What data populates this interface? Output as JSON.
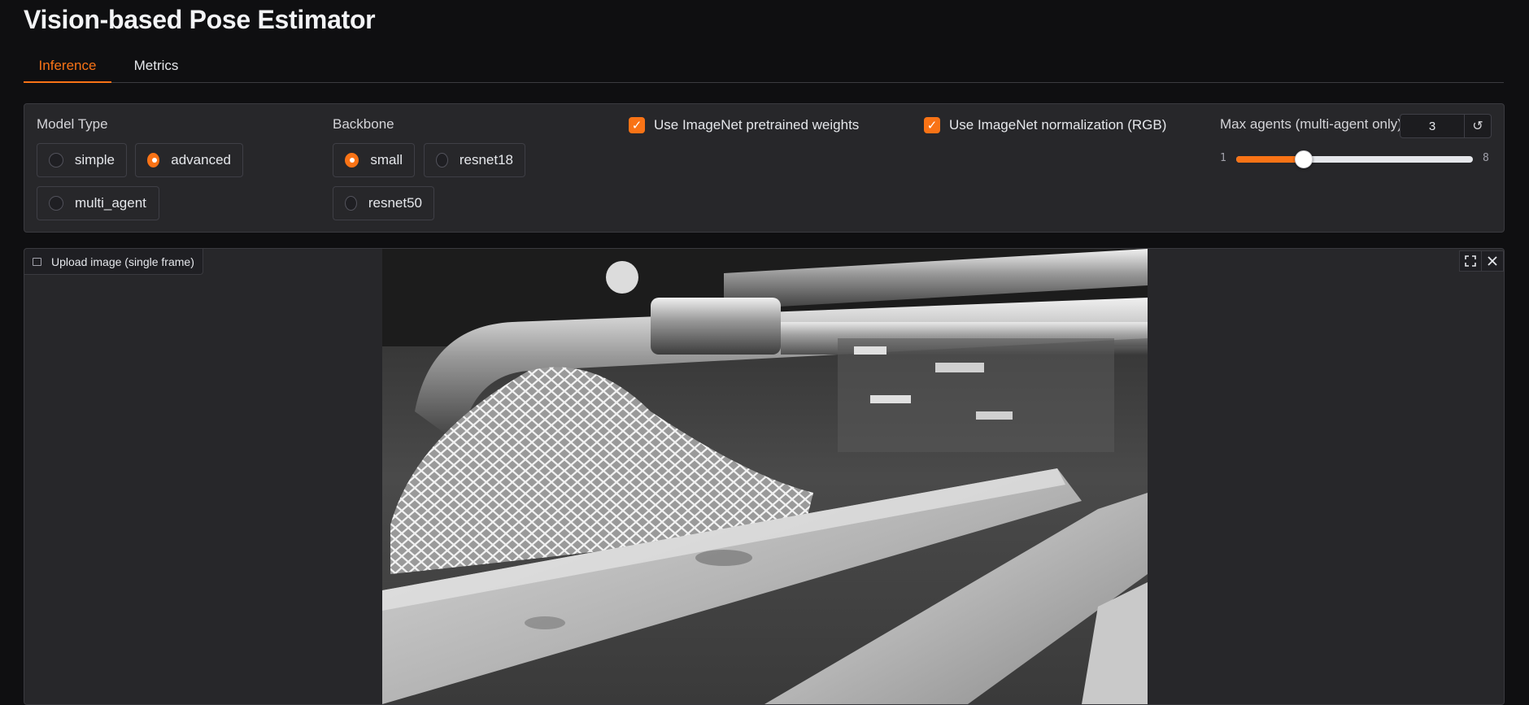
{
  "app": {
    "title": "Vision-based Pose Estimator"
  },
  "tabs": [
    {
      "label": "Inference",
      "active": true
    },
    {
      "label": "Metrics",
      "active": false
    }
  ],
  "model_type": {
    "label": "Model Type",
    "options": [
      "simple",
      "advanced",
      "multi_agent"
    ],
    "selected": "advanced"
  },
  "backbone": {
    "label": "Backbone",
    "options": [
      "small",
      "resnet18",
      "resnet50"
    ],
    "selected": "small"
  },
  "checkboxes": {
    "pretrained": {
      "label": "Use ImageNet pretrained weights",
      "checked": true
    },
    "normalization": {
      "label": "Use ImageNet normalization (RGB)",
      "checked": true
    }
  },
  "max_agents": {
    "label": "Max agents (multi-agent only)",
    "value": "3",
    "min": "1",
    "max": "8",
    "reset_icon": "reset-icon"
  },
  "upload": {
    "label": "Upload image (single frame)",
    "icon": "image-icon",
    "fullscreen_icon": "fullscreen-icon",
    "close_icon": "close-icon"
  },
  "colors": {
    "accent": "#f97316",
    "background": "#0f0f11",
    "panel": "#27272a"
  }
}
